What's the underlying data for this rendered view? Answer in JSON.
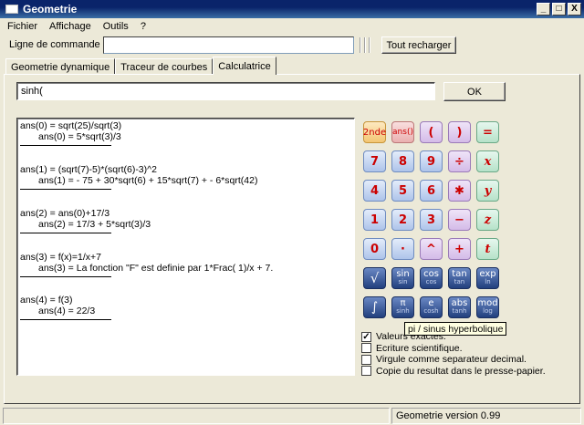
{
  "window": {
    "title": "Geometrie",
    "min": "_",
    "max": "□",
    "close": "X"
  },
  "menu": [
    "Fichier",
    "Affichage",
    "Outils",
    "?"
  ],
  "command": {
    "label": "Ligne de commande :",
    "value": "",
    "reload": "Tout recharger"
  },
  "tabs": [
    "Geometrie dynamique",
    "Traceur de courbes",
    "Calculatrice"
  ],
  "calc": {
    "input": "sinh(",
    "ok": "OK",
    "history": [
      {
        "q": "ans(0) = sqrt(25)/sqrt(3)",
        "a": "ans(0) = 5*sqrt(3)/3"
      },
      {
        "q": "ans(1) = (sqrt(7)-5)*(sqrt(6)-3)^2",
        "a": "ans(1) = - 75 + 30*sqrt(6) + 15*sqrt(7) + - 6*sqrt(42)"
      },
      {
        "q": "ans(2) = ans(0)+17/3",
        "a": "ans(2) = 17/3 + 5*sqrt(3)/3"
      },
      {
        "q": "ans(3) = f(x)=1/x+7",
        "a": "ans(3) = La fonction \"F\" est definie par 1*Frac( 1)/x + 7."
      },
      {
        "q": "ans(4) = f(3)",
        "a": "ans(4) = 22/3"
      }
    ],
    "keys": {
      "second": "2nde",
      "ans": "ans()",
      "lparen": "(",
      "rparen": ")",
      "equals": "=",
      "n7": "7",
      "n8": "8",
      "n9": "9",
      "divide": "÷",
      "var_x": "x",
      "n4": "4",
      "n5": "5",
      "n6": "6",
      "multiply": "✱",
      "var_y": "y",
      "n1": "1",
      "n2": "2",
      "n3": "3",
      "minus": "−",
      "var_z": "z",
      "n0": "0",
      "dot": "·",
      "power": "^",
      "plus": "+",
      "var_t": "t",
      "sqrt": "√",
      "sin": "sin",
      "sin_sub": "sin",
      "cos": "cos",
      "cos_sub": "cos",
      "tan": "tan",
      "tan_sub": "tan",
      "exp": "exp",
      "exp_sub": "ln",
      "int": "∫",
      "pi": "π",
      "pi_sub": "sinh",
      "e": "e",
      "e_sub": "cosh",
      "abs": "abs",
      "abs_sub": "tanh",
      "mod": "mod",
      "mod_sub": "log"
    },
    "tooltip": "pi / sinus hyperbolique",
    "options": [
      {
        "label": "Valeurs exactes.",
        "checked": "✓"
      },
      {
        "label": "Ecriture scientifique.",
        "checked": ""
      },
      {
        "label": "Virgule comme separateur decimal.",
        "checked": ""
      },
      {
        "label": "Copie du resultat dans le presse-papier.",
        "checked": ""
      }
    ]
  },
  "status": {
    "left": "",
    "version": "Geometrie version 0.99"
  }
}
